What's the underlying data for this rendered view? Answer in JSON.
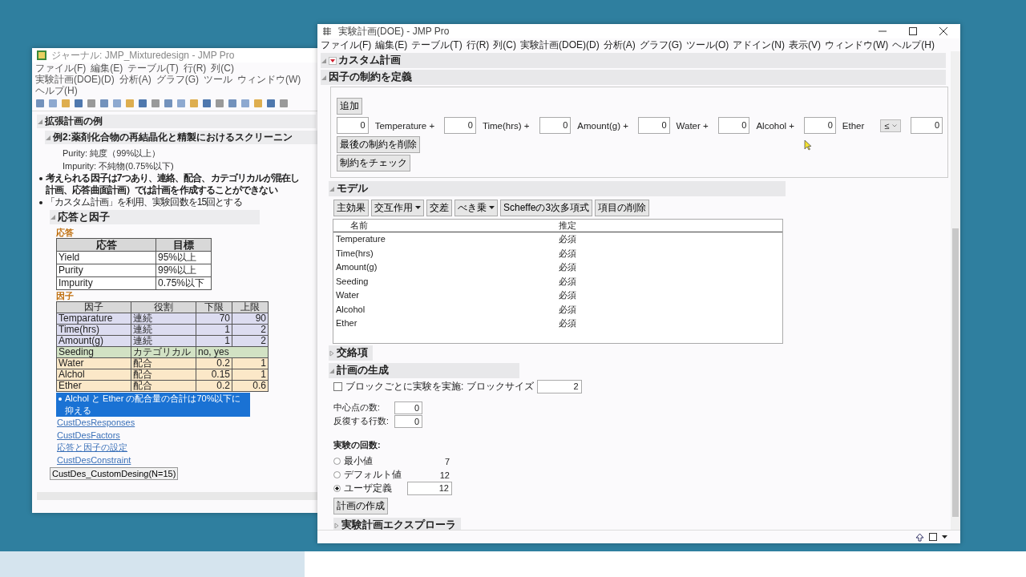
{
  "left_window": {
    "title": "ジャーナル: JMP_Mixturedesign - JMP Pro",
    "menu": [
      "ファイル(F)",
      "編集(E)",
      "テーブル(T)",
      "行(R)",
      "列(C)",
      "実験計画(DOE)(D)",
      "分析(A)",
      "グラフ(G)",
      "ツール",
      "ウィンドウ(W)",
      "ヘルプ(H)"
    ],
    "outline_title": "拡張計画の例",
    "example_title": "例2:薬剤化合物の再結晶化と精製におけるスクリーニン",
    "lines": [
      "Purity: 純度（99%以上）",
      "Impurity: 不純物(0.75%以下)"
    ],
    "bullets": [
      {
        "lines": [
          "考えられる因子は7つあり、連絡、配合、カテゴリカルが混在し",
          "計画、応答曲面計画）では計画を作成することができない"
        ],
        "bold": true
      },
      {
        "lines": [
          "「カスタム計画」を利用、実験回数を15回とする"
        ],
        "bold": false
      }
    ],
    "section_title": "応答と因子",
    "responses_label": "応答",
    "responses_table": {
      "columns": [
        "応答",
        "目標"
      ],
      "rows": [
        [
          "Yield",
          "95%以上"
        ],
        [
          "Purity",
          "99%以上"
        ],
        [
          "Impurity",
          "0.75%以下"
        ]
      ]
    },
    "factors_label": "因子",
    "factors_table": {
      "columns": [
        "因子",
        "役割",
        "下限",
        "上限"
      ],
      "rows": [
        {
          "kind": "continuous",
          "cells": [
            "Temparature",
            "連続",
            "70",
            "90"
          ]
        },
        {
          "kind": "continuous",
          "cells": [
            "Time(hrs)",
            "連続",
            "1",
            "2"
          ]
        },
        {
          "kind": "continuous",
          "cells": [
            "Amount(g)",
            "連続",
            "1",
            "2"
          ]
        },
        {
          "kind": "categorical",
          "cells": [
            "Seeding",
            "カテゴリカル",
            "no, yes"
          ]
        },
        {
          "kind": "mixture",
          "cells": [
            "Water",
            "配合",
            "0.2",
            "1"
          ]
        },
        {
          "kind": "mixture",
          "cells": [
            "Alchol",
            "配合",
            "0.15",
            "1"
          ]
        },
        {
          "kind": "mixture",
          "cells": [
            "Ether",
            "配合",
            "0.2",
            "0.6"
          ]
        }
      ]
    },
    "note": "Alchol と Ether の配合量の合計は70%以下に抑える",
    "links": [
      "CustDesResponses",
      "CustDesFactors",
      "応答と因子の設定",
      "CustDesConstraint"
    ],
    "script_button": "CustDes_CustomDesing(N=15)"
  },
  "right_window": {
    "title": "実験計画(DOE) - JMP Pro",
    "menu": [
      "ファイル(F)",
      "編集(E)",
      "テーブル(T)",
      "行(R)",
      "列(C)",
      "実験計画(DOE)(D)",
      "分析(A)",
      "グラフ(G)",
      "ツール(O)",
      "アドイン(N)",
      "表示(V)",
      "ウィンドウ(W)",
      "ヘルプ(H)"
    ],
    "custom_design_title": "カスタム計画",
    "constraints": {
      "title": "因子の制約を定義",
      "expanded": true,
      "add_button": "追加",
      "terms": [
        {
          "value": "0",
          "label": "Temperature +"
        },
        {
          "value": "0",
          "label": "Time(hrs) +"
        },
        {
          "value": "0",
          "label": "Amount(g) +"
        },
        {
          "value": "0",
          "label": "Water +"
        },
        {
          "value": "0",
          "label": "Alcohol +"
        },
        {
          "value": "0",
          "label": "Ether"
        }
      ],
      "operator": "≤",
      "rhs": "0",
      "buttons": [
        "最後の制約を削除",
        "制約をチェック"
      ]
    },
    "model": {
      "title": "モデル",
      "expanded": true,
      "buttons": [
        {
          "label": "主効果",
          "dropdown": false
        },
        {
          "label": "交互作用",
          "dropdown": true
        },
        {
          "label": "交差",
          "dropdown": false
        },
        {
          "label": "べき乗",
          "dropdown": true
        },
        {
          "label": "Scheffeの3次多項式",
          "dropdown": false
        },
        {
          "label": "項目の削除",
          "dropdown": false
        }
      ],
      "columns": [
        "名前",
        "推定"
      ],
      "rows": [
        [
          "Temperature",
          "必須"
        ],
        [
          "Time(hrs)",
          "必須"
        ],
        [
          "Amount(g)",
          "必須"
        ],
        [
          "Seeding",
          "必須"
        ],
        [
          "Water",
          "必須"
        ],
        [
          "Alcohol",
          "必須"
        ],
        [
          "Ether",
          "必須"
        ]
      ]
    },
    "aliasing": {
      "title": "交絡項",
      "expanded": false
    },
    "generation": {
      "title": "計画の生成",
      "expanded": true,
      "blocking": {
        "label": "ブロックごとに実験を実施: ブロックサイズ",
        "checked": false,
        "value": "2"
      },
      "fields": [
        {
          "label": "中心点の数:",
          "value": "0"
        },
        {
          "label": "反復する行数:",
          "value": "0"
        }
      ],
      "runs_title": "実験の回数:",
      "run_options": [
        {
          "label": "最小値",
          "value": "7",
          "selected": false,
          "kind": "text"
        },
        {
          "label": "デフォルト値",
          "value": "12",
          "selected": false,
          "kind": "text"
        },
        {
          "label": "ユーザ定義",
          "value": "12",
          "selected": true,
          "kind": "field"
        }
      ],
      "make_button": "計画の作成"
    },
    "explorer": {
      "title": "実験計画エクスプローラ",
      "expanded": false
    }
  }
}
